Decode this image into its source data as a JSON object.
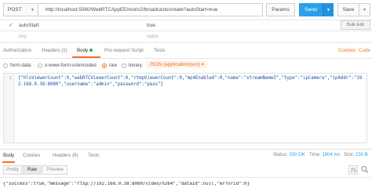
{
  "request": {
    "method": "POST",
    "url": "http://localhost:5080/WebRTCAppEE/rest/v2/broadcasts/create?autoStart=true",
    "params_label": "Params",
    "send_label": "Send",
    "save_label": "Save"
  },
  "params": {
    "rows": [
      {
        "key": "autoStart",
        "value": "true"
      }
    ],
    "key_placeholder": "key",
    "value_placeholder": "value",
    "bulk_edit_label": "Bulk Edit"
  },
  "tabs": {
    "authorization": "Authorization",
    "headers": "Headers (1)",
    "body": "Body",
    "prerequest": "Pre-request Script",
    "tests": "Tests",
    "cookies": "Cookies",
    "code": "Code"
  },
  "body_types": {
    "form_data": "form-data",
    "urlencoded": "x-www-form-urlencoded",
    "raw": "raw",
    "binary": "binary",
    "selected": "raw",
    "content_type": "JSON (application/json)"
  },
  "editor": {
    "line_number": "1",
    "content": "{\"hlsViewerCount\":0,\"webRTCViewerCount\":0,\"rtmpViewerCount\":0,\"mp4Enabled\":0,\"name\":\"streamName3\",\"type\":\"ipCamera\",\"ipAddr\":\"192.168.0.38:8080\",\"username\":\"admin\",\"password\":\"pass\"}"
  },
  "response": {
    "tabs": {
      "body": "Body",
      "cookies": "Cookies",
      "headers": "Headers (6)",
      "tests": "Tests"
    },
    "status_label": "Status:",
    "status_value": "200 OK",
    "time_label": "Time:",
    "time_value": "1904 ms",
    "size_label": "Size:",
    "size_value": "230 B",
    "formats": {
      "pretty": "Pretty",
      "raw": "Raw",
      "preview": "Preview"
    },
    "body_text": "{\"success\":true,\"message\":\"rtsp://192.168.0.38:8080/video/h264\",\"dataId\":null,\"errorId\":0}"
  },
  "colors": {
    "accent": "#f47023",
    "send_button": "#2aa0e8",
    "status_ok": "#2ab34a"
  }
}
